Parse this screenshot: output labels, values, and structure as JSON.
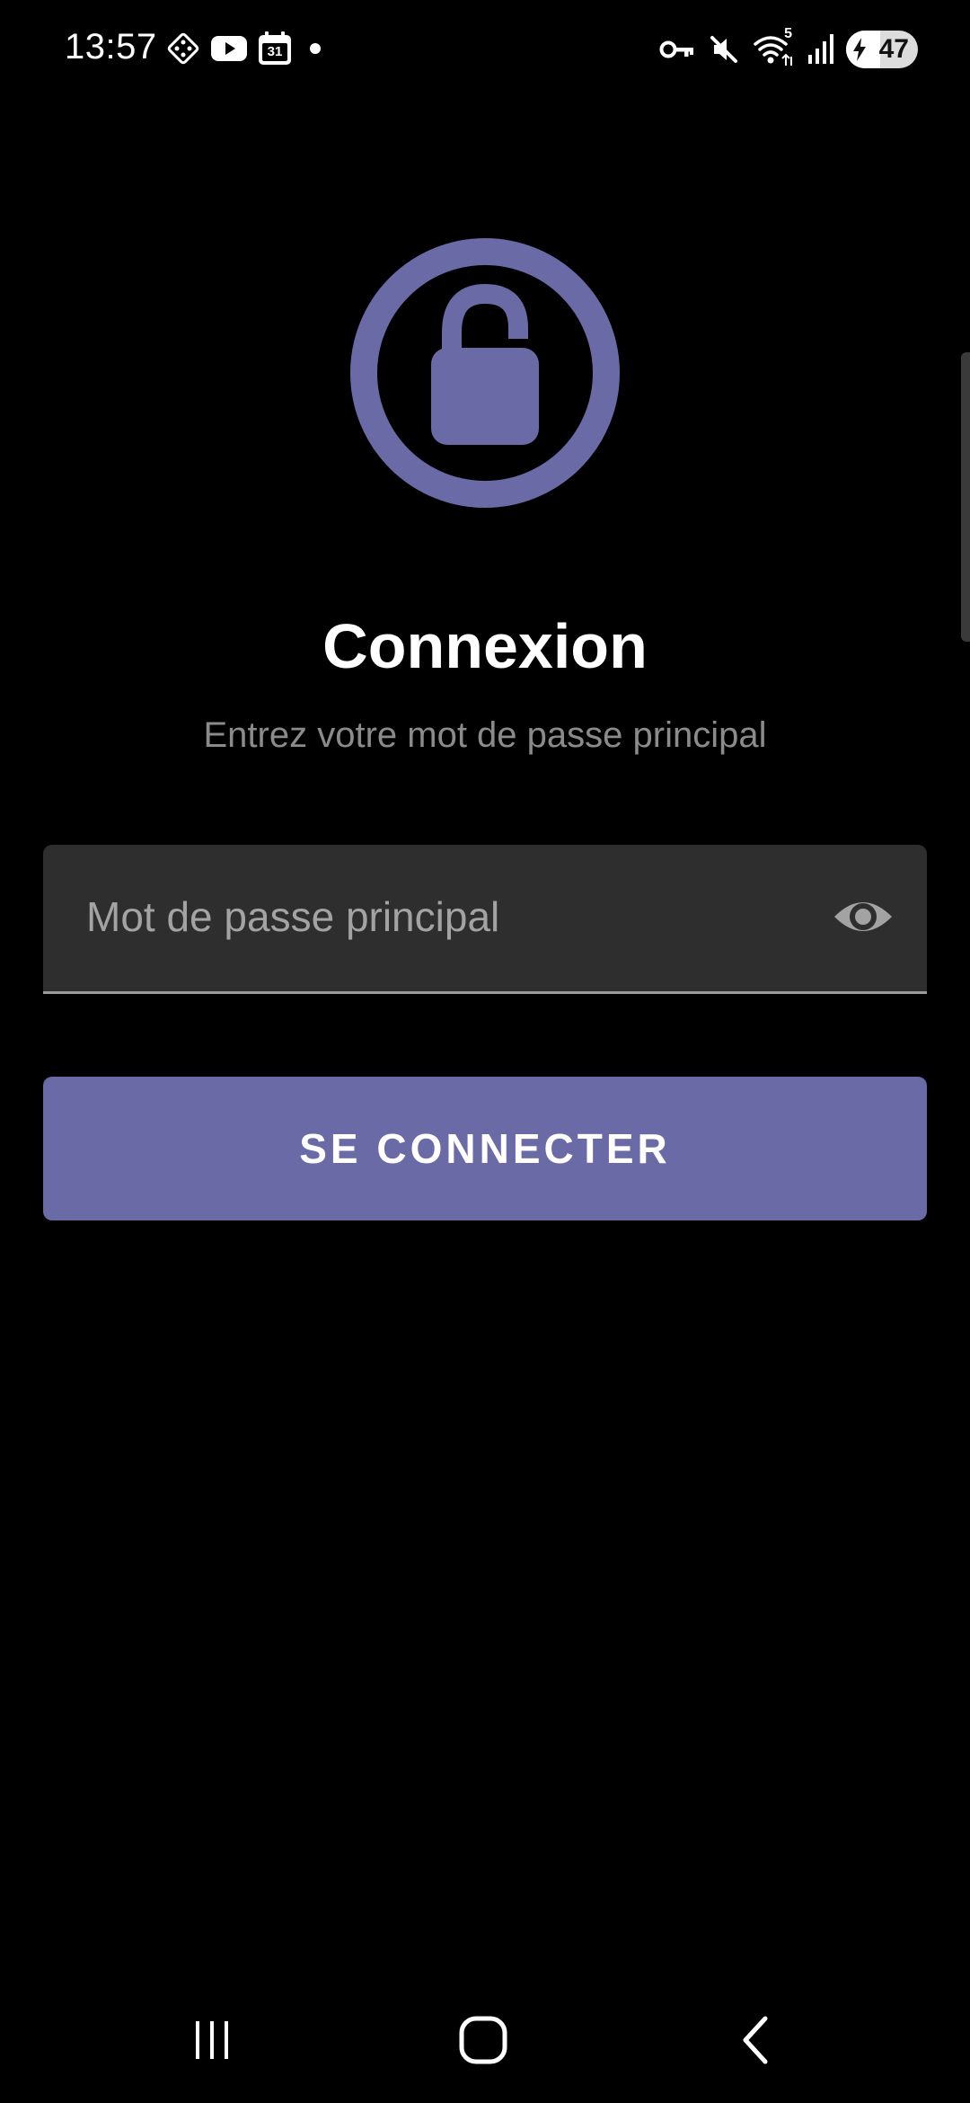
{
  "status_bar": {
    "time": "13:57",
    "left_icons": [
      "game-controller-icon",
      "youtube-icon",
      "calendar-icon",
      "notification-dot-icon"
    ],
    "calendar_day": "31",
    "right_icons": [
      "vpn-key-icon",
      "mute-icon",
      "wifi-icon",
      "signal-icon",
      "battery-icon"
    ],
    "wifi_badge": "5",
    "battery_level": "47",
    "battery_charge_fraction": 0.47,
    "charging": true
  },
  "login": {
    "title": "Connexion",
    "subtitle": "Entrez votre mot de passe principal",
    "password_field": {
      "placeholder": "Mot de passe principal",
      "value": ""
    },
    "submit_label": "SE CONNECTER"
  },
  "colors": {
    "accent": "#6a6aa6",
    "background": "#000000",
    "field_background": "#2e2e2e",
    "subtitle_text": "#8b8b8b"
  },
  "navigation_bar": {
    "buttons": [
      "recent-apps-icon",
      "home-icon",
      "back-icon"
    ]
  }
}
